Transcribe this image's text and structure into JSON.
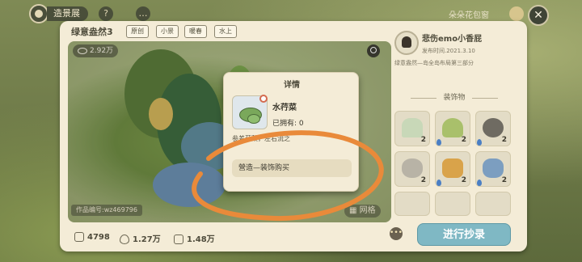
{
  "topbar": {
    "title": "造景展",
    "help_label": "?",
    "right_label": "朵朵花包窗",
    "close_label": "✕"
  },
  "design": {
    "title": "绿意盎然3",
    "tags": [
      "原创",
      "小景",
      "暖春",
      "水上"
    ],
    "views": "2.92万",
    "work_id": "作品编号:wz469796",
    "grid_label": "网格"
  },
  "stats": [
    {
      "icon": "likes-icon",
      "value": "4798"
    },
    {
      "icon": "drop-icon",
      "value": "1.27万"
    },
    {
      "icon": "copy-icon",
      "value": "1.48万"
    }
  ],
  "author": {
    "name": "悲伤emo小香屁",
    "publish_time": "发布时间.2021.3.10",
    "series": "绿意盎然—岛全岛布局第三部分"
  },
  "decorations": {
    "header": "装饰物",
    "items": [
      {
        "name": "reed-grass",
        "count": "2",
        "color": "#c8d8b8"
      },
      {
        "name": "fern-bush",
        "count": "2",
        "color": "#a9c06b"
      },
      {
        "name": "rock-cluster",
        "count": "2",
        "color": "#6f6b62"
      },
      {
        "name": "stone-pile",
        "count": "2",
        "color": "#b8b3a6"
      },
      {
        "name": "flower-patch",
        "count": "2",
        "color": "#d9a34a"
      },
      {
        "name": "blue-shrub",
        "count": "2",
        "color": "#7c9ec0"
      }
    ]
  },
  "actions": {
    "proceed_label": "进行抄录",
    "more_label": "•••"
  },
  "dialog": {
    "title": "详情",
    "item_name": "水荇菜",
    "owned": "已拥有: 0",
    "description": "参差荇菜，左右流之",
    "source": "營造—装饰购买"
  },
  "colors": {
    "panel": "#f4ecd7",
    "button": "#7fb8c4",
    "annotation": "#e98a3a"
  }
}
